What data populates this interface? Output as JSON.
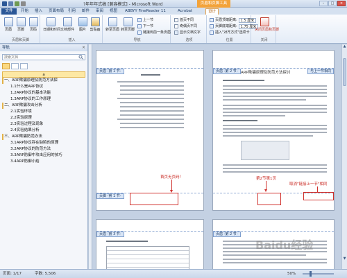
{
  "window": {
    "title": "?年年年式稿 [兼容模式] - Microsoft Word",
    "context_group": "页眉和页脚工具",
    "min_label": "–",
    "max_label": "□",
    "close_label": "×"
  },
  "tabs": {
    "file": "文件",
    "items": [
      "开始",
      "插入",
      "页面布局",
      "引用",
      "邮件",
      "审阅",
      "视图",
      "ABBYY FineReader 11",
      "Acrobat",
      "设计"
    ],
    "active_index": 9
  },
  "ribbon": {
    "groups": {
      "header_footer": {
        "label": "页眉和页脚",
        "buttons": [
          "页眉",
          "页脚",
          "页码"
        ]
      },
      "insert": {
        "label": "插入",
        "buttons": [
          "日期和时间",
          "文档部件",
          "图片",
          "剪贴画"
        ]
      },
      "navigation": {
        "label": "导航",
        "big_buttons": [
          "转至页眉",
          "转至页脚"
        ],
        "small_buttons": [
          "上一节",
          "下一节",
          "链接到前一条页眉"
        ]
      },
      "options": {
        "label": "选项",
        "checks": [
          "首页不同",
          "奇偶页不同",
          "显示文档文字"
        ]
      },
      "position": {
        "label": "位置",
        "rows": [
          {
            "label": "页眉顶端距离:",
            "value": "1.5 厘米"
          },
          {
            "label": "页脚底端距离:",
            "value": "1.75 厘米"
          },
          {
            "label": "插入\"对齐方式\"选项卡",
            "value": ""
          }
        ]
      },
      "close": {
        "label": "关闭",
        "button": "关闭页眉和页脚"
      }
    }
  },
  "nav_pane": {
    "title": "导航",
    "close_label": "×",
    "search_placeholder": "搜索文档",
    "items": [
      {
        "text": "a",
        "level": 0
      },
      {
        "text": "一、ARP欺骗原理及防范方法探",
        "level": 1
      },
      {
        "text": "1.1什么是ARP协议",
        "level": 2
      },
      {
        "text": "1.2ARP协议的基本功能",
        "level": 2
      },
      {
        "text": "1.3ARP协议的工作原理",
        "level": 2
      },
      {
        "text": "二、ARP欺骗攻击分析",
        "level": 1
      },
      {
        "text": "2.1实验环境",
        "level": 2
      },
      {
        "text": "2.2实验原理",
        "level": 2
      },
      {
        "text": "2.3实验过程及现象",
        "level": 2
      },
      {
        "text": "2.4实验结果分析",
        "level": 2
      },
      {
        "text": "三、ARP欺骗防范办法",
        "level": 1
      },
      {
        "text": "3.1ARP协议存在缺陷的原理",
        "level": 2
      },
      {
        "text": "3.2ARP协议的防范方法",
        "level": 2
      },
      {
        "text": "3.3ARP防御中攻击应用的技巧",
        "level": 2
      },
      {
        "text": "3.4ARP防御小结",
        "level": 2
      }
    ]
  },
  "document": {
    "pages": [
      {
        "header_tag": "页眉 -第 1 节-",
        "footer_tag": "页脚 -第 1 节-"
      },
      {
        "header_tag": "页眉 -第 2 节-",
        "heading": "ARP欺骗原理及防范方法探讨",
        "section_tag": "与上一节相同"
      },
      {
        "header_tag": "页眉 -第 3 节-"
      },
      {
        "header_tag": "页眉 -第 2 节-"
      }
    ],
    "annotations": {
      "first_page_no_number": "首页无页码！",
      "section_break": "第2节第1页",
      "link_previous": "取消\"链接上一节\"相同"
    }
  },
  "statusbar": {
    "page": "页面: 1/17",
    "words": "字数: 5,506",
    "zoom": "50%"
  },
  "watermark": "Baidu经验",
  "colors": {
    "file_tab": "#2b5797",
    "context_group": "#f3a33a",
    "annotation": "#d0312d"
  }
}
